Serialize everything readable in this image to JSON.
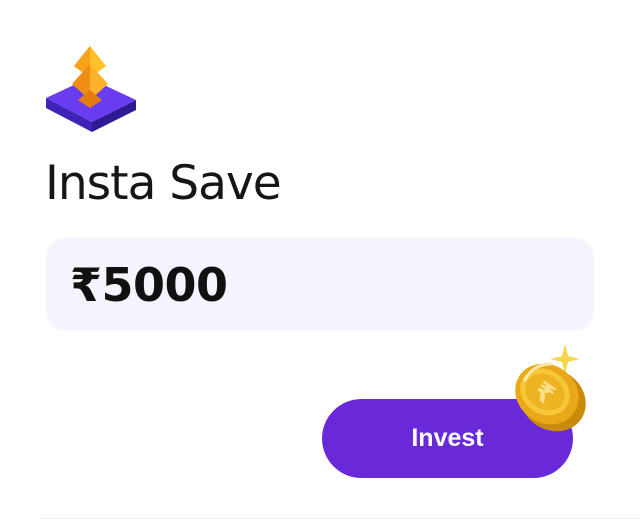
{
  "card": {
    "title": "Insta Save",
    "amount": {
      "currency_symbol": "₹",
      "value": "5000",
      "display": "₹5000"
    },
    "invest_button": {
      "label": "Invest"
    },
    "icons": {
      "logo": "insta-save-logo-icon",
      "coin": "rupee-coin-icon"
    }
  },
  "colors": {
    "accent": "#6a29d9",
    "input_background": "#f5f3fd",
    "logo_orange": "#f7a21b",
    "logo_purple": "#5a2ee0",
    "coin_gold": "#f2b51c"
  }
}
